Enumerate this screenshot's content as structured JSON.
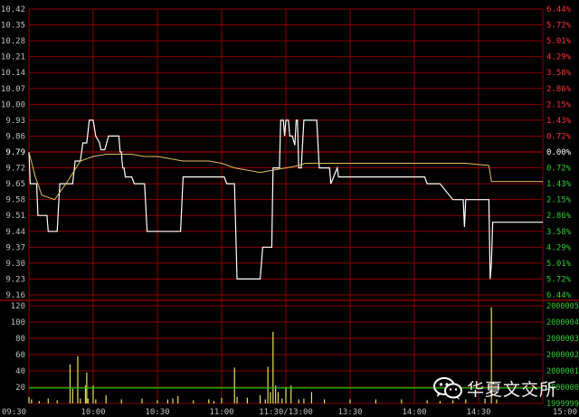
{
  "colors": {
    "background": "#000000",
    "grid": "#8b0000",
    "axis_left_text": "#c0c0c0",
    "axis_right_up": "#ff3333",
    "axis_right_mid": "#ffffff",
    "axis_right_down": "#33cc33",
    "price_line": "#ffffff",
    "avg_line": "#e0c060",
    "volume_bar": "#e8e060",
    "volume_avg_line": "#00cc00",
    "time_text": "#c0c0c0"
  },
  "watermark": {
    "icon": "wechat-icon",
    "text": "华夏文交所"
  },
  "chart_data": {
    "type": "line",
    "title": "",
    "price_axis": {
      "ticks_left": [
        "10.42",
        "10.35",
        "10.28",
        "10.21",
        "10.14",
        "10.07",
        "10.00",
        "9.93",
        "9.86",
        "9.79",
        "9.72",
        "9.65",
        "9.58",
        "9.51",
        "9.44",
        "9.37",
        "9.30",
        "9.23",
        "9.16"
      ],
      "ticks_right": [
        "6.44%",
        "5.72%",
        "5.01%",
        "4.29%",
        "3.58%",
        "2.86%",
        "2.15%",
        "1.43%",
        "0.72%",
        "0.00%",
        "0.72%",
        "1.43%",
        "2.15%",
        "2.86%",
        "3.58%",
        "4.29%",
        "5.01%",
        "5.72%",
        "6.44%"
      ],
      "ylim": [
        9.16,
        10.42
      ],
      "prev_close": 9.79
    },
    "time_axis": [
      "09:30",
      "10:00",
      "10:30",
      "11:00",
      "11:30/13:00",
      "13:30",
      "14:00",
      "14:30",
      "15:00"
    ],
    "series": [
      {
        "points": [
          [
            0,
            9.79
          ],
          [
            1,
            9.65
          ],
          [
            6,
            9.65
          ],
          [
            7,
            9.51
          ],
          [
            14,
            9.51
          ],
          [
            15,
            9.44
          ],
          [
            22,
            9.44
          ],
          [
            24,
            9.65
          ],
          [
            34,
            9.65
          ],
          [
            36,
            9.75
          ],
          [
            40,
            9.75
          ],
          [
            42,
            9.83
          ],
          [
            45,
            9.83
          ],
          [
            47,
            9.93
          ],
          [
            50,
            9.93
          ],
          [
            52,
            9.86
          ],
          [
            55,
            9.83
          ],
          [
            56,
            9.8
          ],
          [
            59,
            9.8
          ],
          [
            62,
            9.86
          ],
          [
            70,
            9.86
          ],
          [
            71,
            9.79
          ],
          [
            72,
            9.79
          ],
          [
            72.5,
            9.75
          ],
          [
            73,
            9.72
          ],
          [
            74,
            9.72
          ],
          [
            75,
            9.68
          ],
          [
            80,
            9.68
          ],
          [
            82,
            9.65
          ],
          [
            90,
            9.65
          ],
          [
            92,
            9.44
          ],
          [
            118,
            9.44
          ],
          [
            120,
            9.68
          ],
          [
            152,
            9.68
          ],
          [
            154,
            9.65
          ],
          [
            160,
            9.65
          ],
          [
            162,
            9.23
          ],
          [
            174,
            9.23
          ],
          [
            176,
            9.23
          ],
          [
            180,
            9.23
          ],
          [
            182,
            9.37
          ],
          [
            189,
            9.37
          ],
          [
            190,
            9.72
          ],
          [
            195,
            9.72
          ],
          [
            196,
            9.93
          ],
          [
            198,
            9.93
          ],
          [
            199,
            9.86
          ],
          [
            200,
            9.93
          ],
          [
            202,
            9.93
          ],
          [
            203,
            9.86
          ],
          [
            205,
            9.86
          ],
          [
            207,
            9.82
          ],
          [
            208,
            9.93
          ],
          [
            209,
            9.93
          ],
          [
            210,
            9.72
          ],
          [
            212,
            9.72
          ],
          [
            214,
            9.93
          ],
          [
            224,
            9.93
          ],
          [
            226,
            9.72
          ],
          [
            234,
            9.72
          ],
          [
            235,
            9.65
          ],
          [
            240,
            9.72
          ],
          [
            241,
            9.68
          ],
          [
            242,
            9.68
          ],
          [
            270,
            9.68
          ],
          [
            290,
            9.68
          ],
          [
            308,
            9.68
          ],
          [
            310,
            9.65
          ],
          [
            320,
            9.65
          ],
          [
            330,
            9.58
          ],
          [
            338,
            9.58
          ],
          [
            339,
            9.46
          ],
          [
            340,
            9.58
          ],
          [
            350,
            9.58
          ],
          [
            358,
            9.58
          ],
          [
            359,
            9.23
          ],
          [
            360,
            9.3
          ],
          [
            361,
            9.48
          ],
          [
            400,
            9.48
          ]
        ]
      },
      {
        "points": [
          [
            0,
            9.79
          ],
          [
            5,
            9.68
          ],
          [
            10,
            9.6
          ],
          [
            20,
            9.58
          ],
          [
            30,
            9.66
          ],
          [
            40,
            9.75
          ],
          [
            50,
            9.77
          ],
          [
            60,
            9.78
          ],
          [
            80,
            9.78
          ],
          [
            90,
            9.77
          ],
          [
            100,
            9.77
          ],
          [
            110,
            9.76
          ],
          [
            120,
            9.75
          ],
          [
            140,
            9.75
          ],
          [
            150,
            9.74
          ],
          [
            160,
            9.72
          ],
          [
            170,
            9.71
          ],
          [
            180,
            9.7
          ],
          [
            190,
            9.71
          ],
          [
            200,
            9.72
          ],
          [
            210,
            9.73
          ],
          [
            215,
            9.74
          ],
          [
            220,
            9.74
          ],
          [
            230,
            9.74
          ],
          [
            240,
            9.74
          ],
          [
            260,
            9.74
          ],
          [
            300,
            9.74
          ],
          [
            320,
            9.74
          ],
          [
            340,
            9.74
          ],
          [
            358,
            9.73
          ],
          [
            360,
            9.66
          ],
          [
            400,
            9.66
          ]
        ]
      }
    ],
    "volume": {
      "yticks_left": [
        "120",
        "100",
        "80",
        "60",
        "40",
        "20"
      ],
      "yticks_right": [
        "2000005",
        "2000004",
        "2000003",
        "2000002",
        "2000001",
        "2000000",
        "1999999"
      ],
      "ylim": [
        0,
        120
      ],
      "bars": [
        [
          0,
          8
        ],
        [
          2,
          5
        ],
        [
          8,
          3
        ],
        [
          15,
          6
        ],
        [
          22,
          4
        ],
        [
          32,
          48
        ],
        [
          34,
          18
        ],
        [
          38,
          58
        ],
        [
          40,
          6
        ],
        [
          44,
          22
        ],
        [
          45,
          38
        ],
        [
          46,
          6
        ],
        [
          50,
          22
        ],
        [
          52,
          5
        ],
        [
          60,
          10
        ],
        [
          72,
          5
        ],
        [
          88,
          6
        ],
        [
          100,
          4
        ],
        [
          108,
          5
        ],
        [
          112,
          6
        ],
        [
          116,
          9
        ],
        [
          128,
          4
        ],
        [
          140,
          5
        ],
        [
          144,
          3
        ],
        [
          150,
          7
        ],
        [
          160,
          44
        ],
        [
          162,
          8
        ],
        [
          170,
          7
        ],
        [
          180,
          10
        ],
        [
          184,
          5
        ],
        [
          186,
          45
        ],
        [
          188,
          14
        ],
        [
          190,
          88
        ],
        [
          192,
          22
        ],
        [
          194,
          14
        ],
        [
          197,
          6
        ],
        [
          200,
          20
        ],
        [
          204,
          22
        ],
        [
          210,
          5
        ],
        [
          214,
          6
        ],
        [
          220,
          14
        ],
        [
          230,
          5
        ],
        [
          250,
          5
        ],
        [
          270,
          5
        ],
        [
          290,
          5
        ],
        [
          310,
          4
        ],
        [
          320,
          3
        ],
        [
          330,
          4
        ],
        [
          340,
          5
        ],
        [
          355,
          6
        ],
        [
          360,
          118
        ],
        [
          364,
          5
        ]
      ],
      "avg_level": 19
    }
  }
}
